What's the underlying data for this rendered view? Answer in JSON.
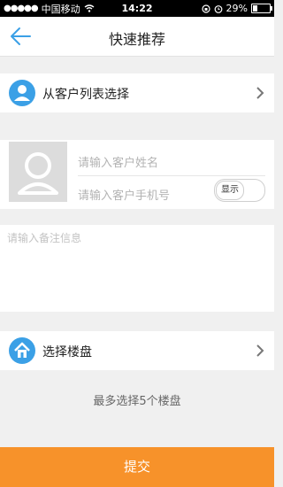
{
  "status_bar": {
    "carrier": "中国移动",
    "time": "14:22",
    "battery": "29%",
    "battery_level": 0.29
  },
  "header": {
    "title": "快速推荐"
  },
  "select_from_list": {
    "label": "从客户列表选择"
  },
  "customer": {
    "name_placeholder": "请输入客户姓名",
    "phone_placeholder": "请输入客户手机号",
    "show_toggle_label": "显示"
  },
  "remark": {
    "placeholder": "请输入备注信息"
  },
  "property": {
    "label": "选择楼盘",
    "hint": "最多选择5个楼盘"
  },
  "submit_label": "提交",
  "colors": {
    "accent": "#3ba0e6",
    "submit": "#f7922a"
  }
}
